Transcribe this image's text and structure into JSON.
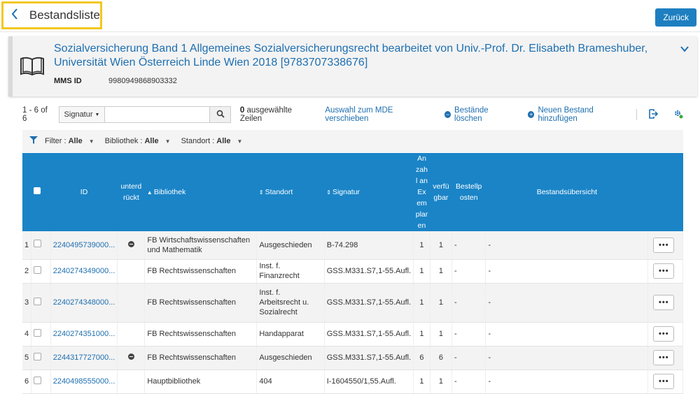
{
  "header": {
    "back_title": "Bestandsliste",
    "back_button_label": "Zurück"
  },
  "record": {
    "title": "Sozialversicherung Band 1 Allgemeines Sozialversicherungsrecht bearbeitet von Univ.-Prof. Dr. Elisabeth Brameshuber, Universität Wien Österreich Linde Wien 2018 [9783707338676]",
    "mms_label": "MMS ID",
    "mms_value": "9980949868903332"
  },
  "toolbar": {
    "count": "1 - 6 of 6",
    "search_field": "Signatur",
    "search_placeholder": "",
    "selected_count": "0",
    "selected_label": "ausgewählte Zeilen",
    "move_label": "Auswahl zum MDE verschieben",
    "delete_label": "Bestände löschen",
    "add_label": "Neuen Bestand hinzufügen"
  },
  "filters": [
    {
      "label": "Filter :",
      "value": "Alle"
    },
    {
      "label": "Bibliothek :",
      "value": "Alle"
    },
    {
      "label": "Standort :",
      "value": "Alle"
    }
  ],
  "table": {
    "headers": {
      "id": "ID",
      "suppressed": "unterdrückt",
      "library": "Bibliothek",
      "location": "Standort",
      "callnumber": "Signatur",
      "copies": "Anzahl an Exemplaren",
      "available": "verfügbar",
      "orders": "Bestellposten",
      "summary": "Bestandsübersicht"
    },
    "rows": [
      {
        "num": "1",
        "id": "2240495739000...",
        "suppressed": true,
        "library": "FB Wirtschaftswissenschaften und Mathematik",
        "location": "Ausgeschieden",
        "callnumber": "B-74.298",
        "copies": "1",
        "available": "1",
        "orders": "-",
        "summary": "-",
        "more": "•••"
      },
      {
        "num": "2",
        "id": "2240274349000...",
        "suppressed": false,
        "library": "FB Rechtswissenschaften",
        "location": "Inst. f. Finanzrecht",
        "callnumber": "GSS.M331.S7,1-55.Aufl.",
        "copies": "1",
        "available": "1",
        "orders": "-",
        "summary": "-",
        "more": "•••"
      },
      {
        "num": "3",
        "id": "2240274348000...",
        "suppressed": false,
        "library": "FB Rechtswissenschaften",
        "location": "Inst. f. Arbeitsrecht u. Sozialrecht",
        "callnumber": "GSS.M331.S7,1-55.Aufl.",
        "copies": "1",
        "available": "1",
        "orders": "-",
        "summary": "-",
        "more": "•••"
      },
      {
        "num": "4",
        "id": "2240274351000...",
        "suppressed": false,
        "library": "FB Rechtswissenschaften",
        "location": "Handapparat",
        "callnumber": "GSS.M331.S7,1-55.Aufl.",
        "copies": "1",
        "available": "1",
        "orders": "-",
        "summary": "-",
        "more": "•••"
      },
      {
        "num": "5",
        "id": "2244317727000...",
        "suppressed": true,
        "library": "FB Rechtswissenschaften",
        "location": "Ausgeschieden",
        "callnumber": "GSS.M331.S7,1-55.Aufl.",
        "copies": "6",
        "available": "6",
        "orders": "-",
        "summary": "-",
        "more": "•••"
      },
      {
        "num": "6",
        "id": "2240498555000...",
        "suppressed": false,
        "library": "Hauptbibliothek",
        "location": "404",
        "callnumber": "I-1604550/1,55.Aufl.",
        "copies": "1",
        "available": "1",
        "orders": "-",
        "summary": "-",
        "more": "•••"
      }
    ]
  },
  "colors": {
    "accent": "#1e7fc0",
    "table_header": "#1a84c7",
    "highlight_border": "#f2c81f"
  }
}
